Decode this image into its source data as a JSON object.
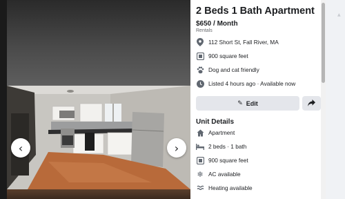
{
  "listing": {
    "title": "2 Beds 1 Bath Apartment",
    "price": "$650 / Month",
    "category": "Rentals"
  },
  "info": [
    {
      "icon": "location-pin-icon",
      "text": "112 Short St, Fall River, MA"
    },
    {
      "icon": "ruler-icon",
      "text": "900 square feet"
    },
    {
      "icon": "paw-icon",
      "text": "Dog and cat friendly"
    },
    {
      "icon": "clock-icon",
      "text": "Listed 4 hours ago · Available now"
    }
  ],
  "actions": {
    "edit_label": "Edit",
    "share_icon": "share-icon"
  },
  "unit_details": {
    "heading": "Unit Details",
    "items": [
      {
        "icon": "house-icon",
        "text": "Apartment"
      },
      {
        "icon": "bed-icon",
        "text": "2 beds · 1 bath"
      },
      {
        "icon": "ruler-icon",
        "text": "900 square feet"
      },
      {
        "icon": "snowflake-icon",
        "text": "AC available"
      },
      {
        "icon": "heater-icon",
        "text": "Heating available"
      }
    ]
  },
  "gallery": {
    "prev_icon": "chevron-left-icon",
    "next_icon": "chevron-right-icon"
  },
  "colors": {
    "panel_bg": "#ffffff",
    "button_bg": "#e4e6eb",
    "icon_gray": "#606770",
    "secondary_text": "#65676b"
  }
}
